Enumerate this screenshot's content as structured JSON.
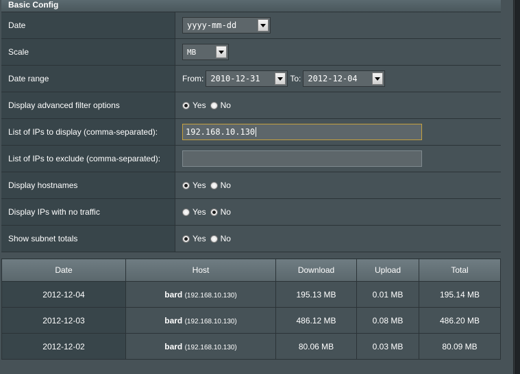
{
  "config": {
    "title": "Basic Config",
    "date": {
      "label": "Date",
      "selected": "yyyy-mm-dd"
    },
    "scale": {
      "label": "Scale",
      "selected": "MB"
    },
    "date_range": {
      "label": "Date range",
      "from_label": "From:",
      "from": "2010-12-31",
      "to_label": "To:",
      "to": "2012-12-04"
    },
    "advanced_filter": {
      "label": "Display advanced filter options",
      "yes": "Yes",
      "no": "No",
      "value": "Yes"
    },
    "ips_display": {
      "label": "List of IPs to display (comma-separated):",
      "value": "192.168.10.130"
    },
    "ips_exclude": {
      "label": "List of IPs to exclude (comma-separated):",
      "value": ""
    },
    "hostnames": {
      "label": "Display hostnames",
      "yes": "Yes",
      "no": "No",
      "value": "Yes"
    },
    "no_traffic": {
      "label": "Display IPs with no traffic",
      "yes": "Yes",
      "no": "No",
      "value": "No"
    },
    "subnet_totals": {
      "label": "Show subnet totals",
      "yes": "Yes",
      "no": "No",
      "value": "Yes"
    }
  },
  "traffic": {
    "headers": [
      "Date",
      "Host",
      "Download",
      "Upload",
      "Total"
    ],
    "rows": [
      {
        "date": "2012-12-04",
        "host": "bard",
        "ip": "(192.168.10.130)",
        "download": "195.13 MB",
        "upload": "0.01 MB",
        "total": "195.14 MB"
      },
      {
        "date": "2012-12-03",
        "host": "bard",
        "ip": "(192.168.10.130)",
        "download": "486.12 MB",
        "upload": "0.08 MB",
        "total": "486.20 MB"
      },
      {
        "date": "2012-12-02",
        "host": "bard",
        "ip": "(192.168.10.130)",
        "download": "80.06 MB",
        "upload": "0.03 MB",
        "total": "80.09 MB"
      }
    ]
  }
}
